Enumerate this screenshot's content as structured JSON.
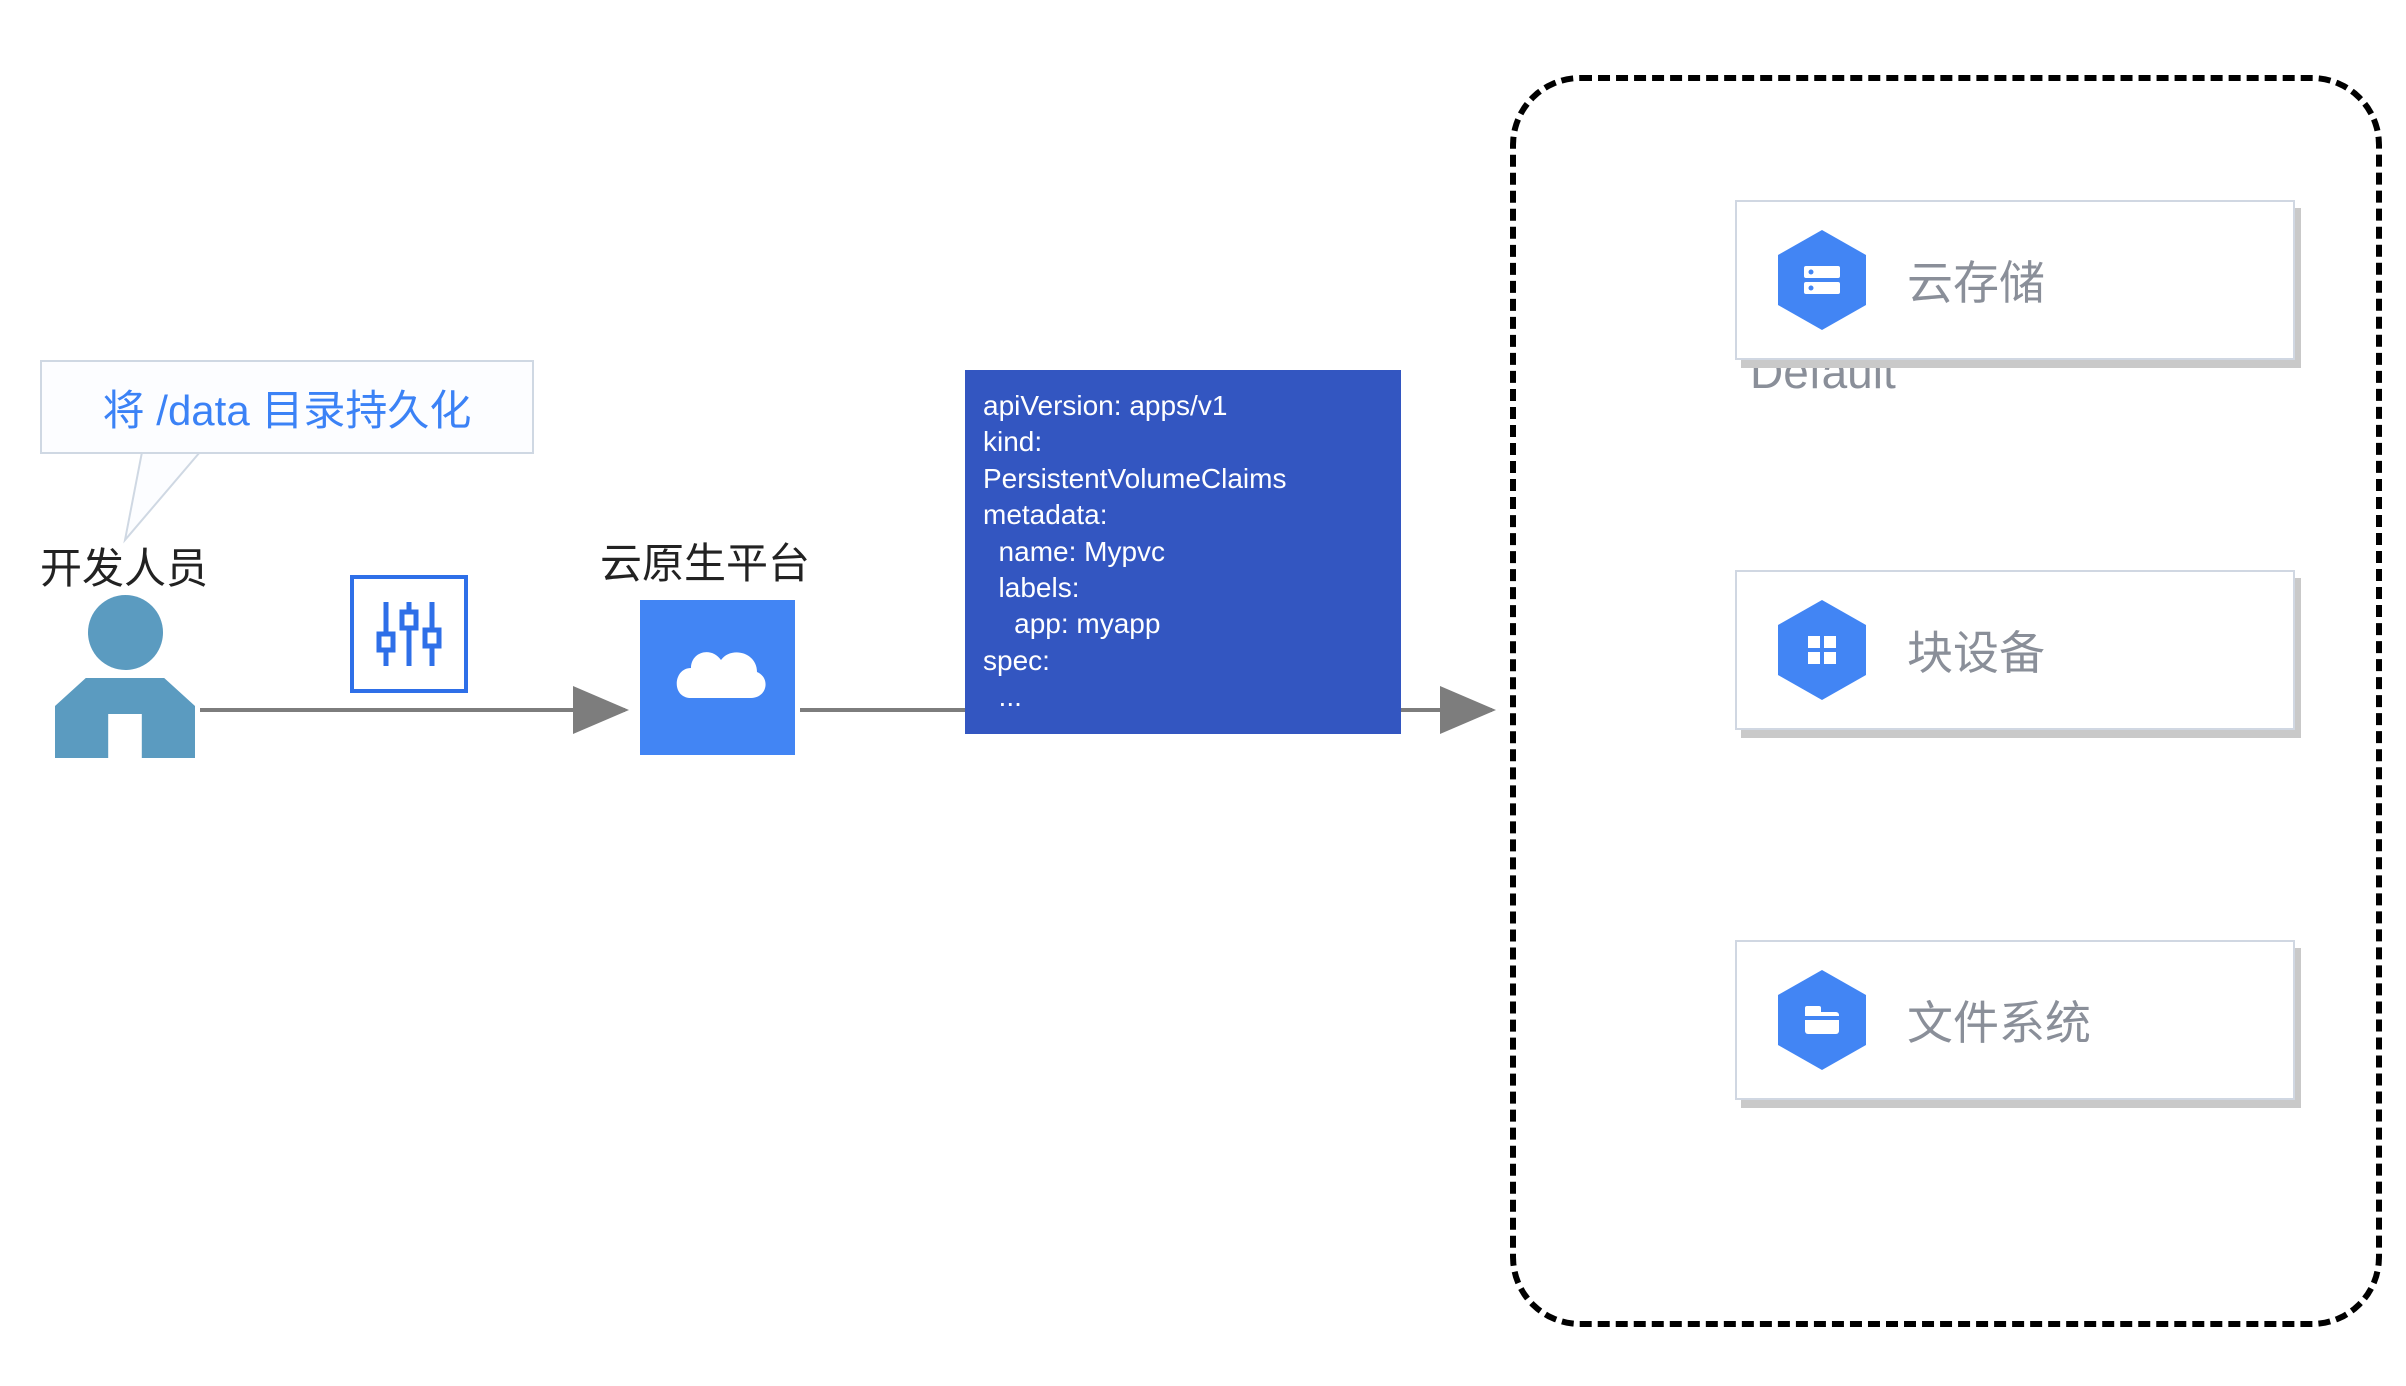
{
  "speech_bubble": "将 /data 目录持久化",
  "developer_label": "开发人员",
  "platform_label": "云原生平台",
  "yaml": {
    "line1": "apiVersion: apps/v1",
    "line2": "kind:",
    "line3": "PersistentVolumeClaims",
    "line4": "metadata:",
    "line5": "  name: Mypvc",
    "line6": "  labels:",
    "line7": "    app: myapp",
    "line8": "spec:",
    "line9": "  ..."
  },
  "default_label": "Default",
  "storage": {
    "card1": {
      "title": "云存储",
      "icon": "disk-stack-icon"
    },
    "card2": {
      "title": "块设备",
      "icon": "blocks-icon"
    },
    "card3": {
      "title": "文件系统",
      "icon": "folder-icon"
    }
  },
  "colors": {
    "primary_blue": "#4285f4",
    "deep_blue": "#3356c1",
    "link_blue": "#3b82f6",
    "person_blue": "#5b9bc0",
    "muted_text": "#8a8f99"
  }
}
